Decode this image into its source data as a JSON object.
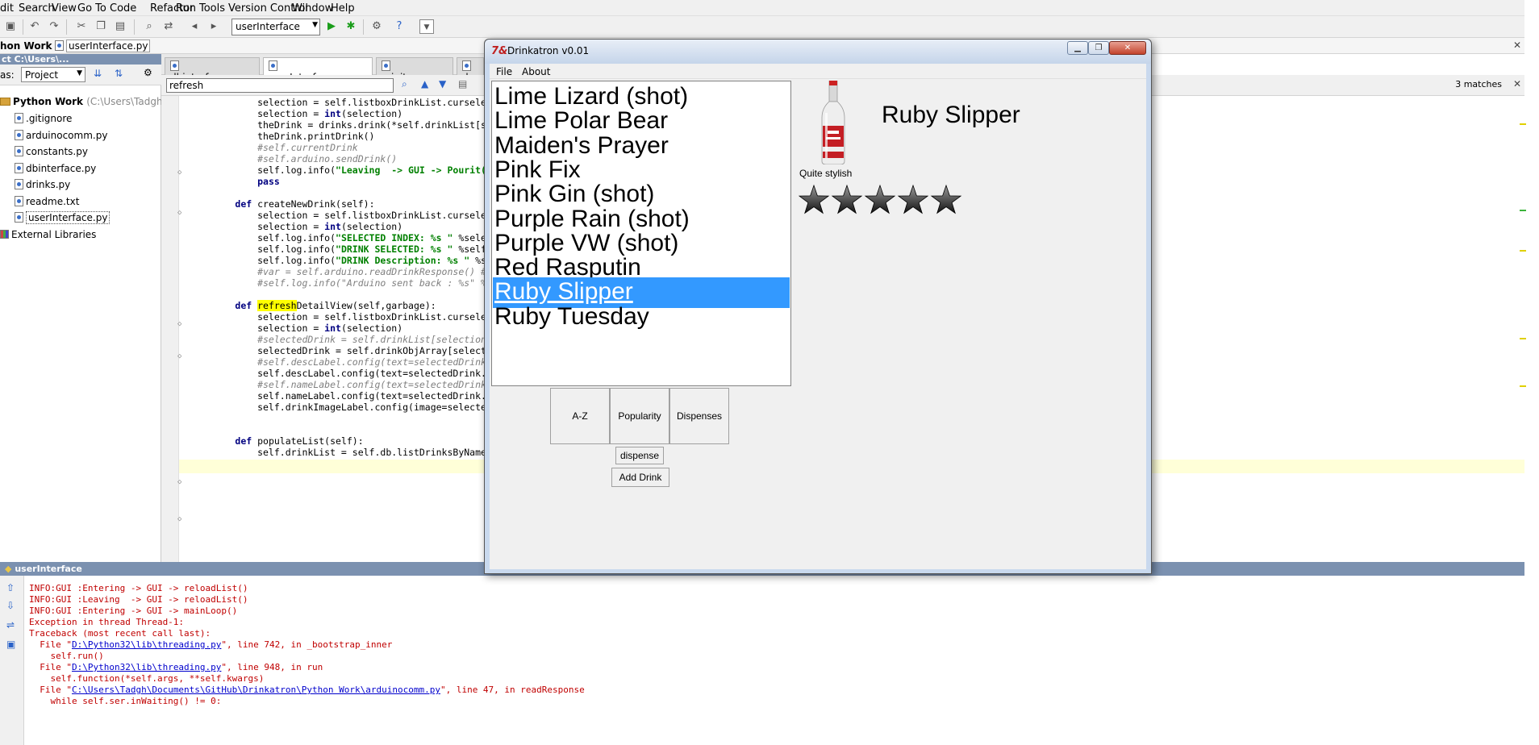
{
  "ide": {
    "menu": [
      "dit",
      "Search",
      "View",
      "Go To",
      "Code",
      "Refactor",
      "Run",
      "Tools",
      "Version Control",
      "Window",
      "Help"
    ],
    "run_config": "userInterface",
    "breadcrumb": {
      "project": "hon Work",
      "file": "userInterface.py"
    },
    "sidebar": {
      "header": "ct  C:\\Users\\...",
      "view_prefix": "as:",
      "view": "Project",
      "root_label": "Python Work",
      "root_path": "(C:\\Users\\Tadgh\\Do",
      "files": [
        ".gitignore",
        "arduinocomm.py",
        "constants.py",
        "dbinterface.py",
        "drinks.py",
        "readme.txt",
        "userInterface.py"
      ],
      "external": "External Libraries"
    },
    "tabs": [
      "dbinterface.py",
      "userInterface.py",
      "__init__.py",
      "d"
    ],
    "search": {
      "value": "refresh",
      "matches": "3 matches"
    },
    "code_lines": [
      {
        "segs": [
          {
            "t": "            selection = self.listboxDrinkList.curselectio"
          }
        ]
      },
      {
        "segs": [
          {
            "t": "            selection = "
          },
          {
            "t": "int",
            "c": "kw"
          },
          {
            "t": "(selection)"
          }
        ]
      },
      {
        "segs": [
          {
            "t": "            theDrink = drinks.drink(*self.drinkList[sele"
          }
        ]
      },
      {
        "segs": [
          {
            "t": "            theDrink.printDrink()"
          }
        ]
      },
      {
        "segs": [
          {
            "t": "            #self.currentDrink",
            "c": "cm"
          }
        ]
      },
      {
        "segs": [
          {
            "t": "            #self.arduino.sendDrink()",
            "c": "cm"
          }
        ]
      },
      {
        "segs": [
          {
            "t": "            self.log.info("
          },
          {
            "t": "\"Leaving  -> GUI -> Pourit()\"",
            "c": "str"
          },
          {
            "t": ")"
          }
        ]
      },
      {
        "segs": [
          {
            "t": "            "
          },
          {
            "t": "pass",
            "c": "kw"
          }
        ]
      },
      {
        "segs": [
          {
            "t": ""
          }
        ]
      },
      {
        "segs": [
          {
            "t": "        "
          },
          {
            "t": "def",
            "c": "kw"
          },
          {
            "t": " createNewDrink(self):"
          }
        ]
      },
      {
        "segs": [
          {
            "t": "            selection = self.listboxDrinkList.curselectio"
          }
        ]
      },
      {
        "segs": [
          {
            "t": "            selection = "
          },
          {
            "t": "int",
            "c": "kw"
          },
          {
            "t": "(selection)"
          }
        ]
      },
      {
        "segs": [
          {
            "t": "            self.log.info("
          },
          {
            "t": "\"SELECTED INDEX: %s \"",
            "c": "str"
          },
          {
            "t": " %selection"
          }
        ]
      },
      {
        "segs": [
          {
            "t": "            self.log.info("
          },
          {
            "t": "\"DRINK SELECTED: %s \"",
            "c": "str"
          },
          {
            "t": " %self.dr"
          }
        ]
      },
      {
        "segs": [
          {
            "t": "            self.log.info("
          },
          {
            "t": "\"DRINK Description: %s \"",
            "c": "str"
          },
          {
            "t": " %sel"
          }
        ]
      },
      {
        "segs": [
          {
            "t": "            #var = self.arduino.readDrinkResponse() #thi",
            "c": "cm"
          }
        ]
      },
      {
        "segs": [
          {
            "t": "            #self.log.info(\"Arduino sent back : %s\" %var",
            "c": "cm"
          }
        ]
      },
      {
        "segs": [
          {
            "t": ""
          }
        ]
      },
      {
        "segs": [
          {
            "t": "        "
          },
          {
            "t": "def",
            "c": "kw"
          },
          {
            "t": " "
          },
          {
            "t": "refresh",
            "c": "hl"
          },
          {
            "t": "DetailView(self,garbage):"
          }
        ]
      },
      {
        "segs": [
          {
            "t": "            selection = self.listboxDrinkList.curselectio"
          }
        ]
      },
      {
        "segs": [
          {
            "t": "            selection = "
          },
          {
            "t": "int",
            "c": "kw"
          },
          {
            "t": "(selection)"
          }
        ]
      },
      {
        "segs": [
          {
            "t": "            #selectedDrink = self.drinkList[selection]",
            "c": "cm"
          }
        ]
      },
      {
        "segs": [
          {
            "t": "            selectedDrink = self.drinkObjArray[selection"
          }
        ]
      },
      {
        "segs": [
          {
            "t": "            #self.descLabel.config(text=selectedDrink[15",
            "c": "cm"
          }
        ]
      },
      {
        "segs": [
          {
            "t": "            self.descLabel.config(text=selectedDrink.des"
          }
        ]
      },
      {
        "segs": [
          {
            "t": "            #self.nameLabel.config(text=selectedDrink[1]",
            "c": "cm"
          }
        ]
      },
      {
        "segs": [
          {
            "t": "            self.nameLabel.config(text=selectedDrink.dri"
          }
        ]
      },
      {
        "segs": [
          {
            "t": "            self.drinkImageLabel.config(image=selectedDr"
          }
        ]
      },
      {
        "segs": [
          {
            "t": ""
          }
        ]
      },
      {
        "segs": [
          {
            "t": ""
          }
        ]
      },
      {
        "segs": [
          {
            "t": "        "
          },
          {
            "t": "def",
            "c": "kw"
          },
          {
            "t": " populateList(self):"
          }
        ]
      },
      {
        "segs": [
          {
            "t": "            self.drinkList = self.db.listDrinksByName()"
          }
        ]
      }
    ],
    "console": {
      "title": "userInterface",
      "lines": [
        {
          "segs": [
            {
              "t": "INFO:GUI :Entering -> GUI -> reloadList()"
            }
          ]
        },
        {
          "segs": [
            {
              "t": "INFO:GUI :Leaving  -> GUI -> reloadList()"
            }
          ]
        },
        {
          "segs": [
            {
              "t": "INFO:GUI :Entering -> GUI -> mainLoop()"
            }
          ]
        },
        {
          "segs": [
            {
              "t": "Exception in thread Thread-1:"
            }
          ]
        },
        {
          "segs": [
            {
              "t": "Traceback (most recent call last):"
            }
          ]
        },
        {
          "segs": [
            {
              "t": "  File \""
            },
            {
              "t": "D:\\Python32\\lib\\threading.py",
              "c": "link"
            },
            {
              "t": "\", line 742, in _bootstrap_inner"
            }
          ]
        },
        {
          "segs": [
            {
              "t": "    self.run()"
            }
          ]
        },
        {
          "segs": [
            {
              "t": "  File \""
            },
            {
              "t": "D:\\Python32\\lib\\threading.py",
              "c": "link"
            },
            {
              "t": "\", line 948, in run"
            }
          ]
        },
        {
          "segs": [
            {
              "t": "    self.function(*self.args, **self.kwargs)"
            }
          ]
        },
        {
          "segs": [
            {
              "t": "  File \""
            },
            {
              "t": "C:\\Users\\Tadgh\\Documents\\GitHub\\Drinkatron\\Python Work\\arduinocomm.py",
              "c": "link"
            },
            {
              "t": "\", line 47, in readResponse"
            }
          ]
        },
        {
          "segs": [
            {
              "t": "    while self.ser.inWaiting() != 0:"
            }
          ]
        }
      ]
    }
  },
  "app": {
    "title": "Drinkatron v0.01",
    "menu": [
      "File",
      "About"
    ],
    "drinks": [
      "Lime Lizard (shot)",
      "Lime Polar Bear",
      "Maiden's Prayer",
      "Pink Fix",
      "Pink Gin (shot)",
      "Purple Rain (shot)",
      "Purple VW (shot)",
      "Red Rasputin",
      "Ruby Slipper",
      "Ruby Tuesday"
    ],
    "selected_index": 8,
    "sort_buttons": [
      "A-Z",
      "Popularity",
      "Dispenses"
    ],
    "dispense_label": "dispense",
    "add_drink_label": "Add Drink",
    "detail": {
      "name": "Ruby Slipper",
      "description": "Quite stylish",
      "rating": 5,
      "rating_max": 5
    }
  }
}
